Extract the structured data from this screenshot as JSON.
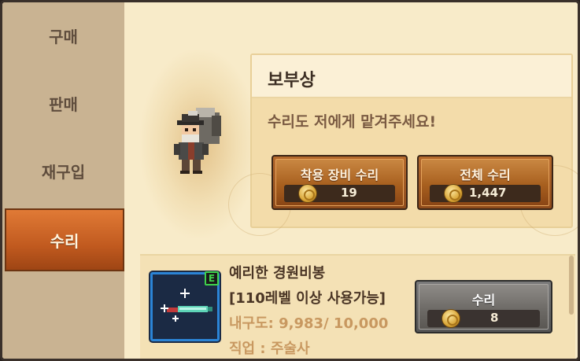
{
  "sidebar": {
    "tabs": [
      {
        "label": "구매",
        "active": false
      },
      {
        "label": "판매",
        "active": false
      },
      {
        "label": "재구입",
        "active": false
      },
      {
        "label": "수리",
        "active": true
      }
    ]
  },
  "npc": {
    "name": "보부상",
    "message": "수리도 저에게 맡겨주세요!"
  },
  "actions": {
    "repair_equipped": {
      "label": "착용 장비 수리",
      "cost": "19"
    },
    "repair_all": {
      "label": "전체 수리",
      "cost": "1,447"
    }
  },
  "items": [
    {
      "name": "예리한 경원비봉",
      "requirement": "[110레벨 이상 사용가능]",
      "durability": "내구도: 9,983/ 10,000",
      "job": "직업 : 주술사",
      "equipped_badge": "E",
      "repair_label": "수리",
      "repair_cost": "8"
    }
  ],
  "colors": {
    "active_tab": "#c15a1f",
    "item_frame": "#2b84d6",
    "equip_badge": "#3fd24c"
  }
}
